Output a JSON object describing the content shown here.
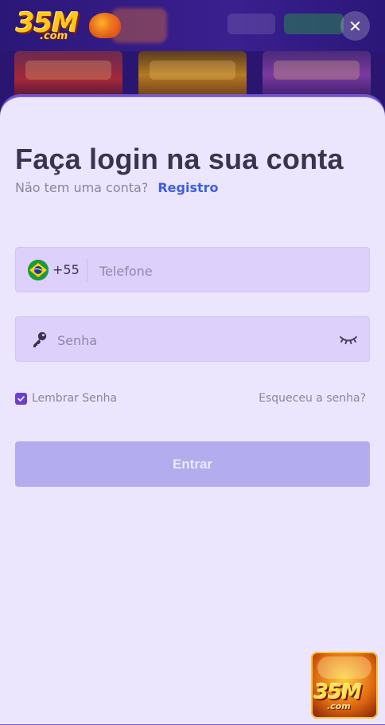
{
  "header": {
    "logo_text": "35M",
    "logo_sub": ".com",
    "close_label": "✕"
  },
  "login": {
    "title": "Faça login na sua conta",
    "no_account": "Não tem uma conta?",
    "register_link": "Registro",
    "country_code": "+55",
    "phone_placeholder": "Telefone",
    "password_placeholder": "Senha",
    "remember_label": "Lembrar Senha",
    "remember_checked": true,
    "forgot_link": "Esqueceu a senha?",
    "submit_label": "Entrar"
  },
  "floating_app": {
    "logo_text": "35M",
    "logo_sub": ".com"
  },
  "colors": {
    "sheet_bg": "#ebe6fd",
    "field_bg": "#ddd1fb",
    "accent": "#3d5ee0",
    "checkbox": "#6a3fd4",
    "button_disabled": "#b3acee",
    "title": "#3b3350"
  }
}
